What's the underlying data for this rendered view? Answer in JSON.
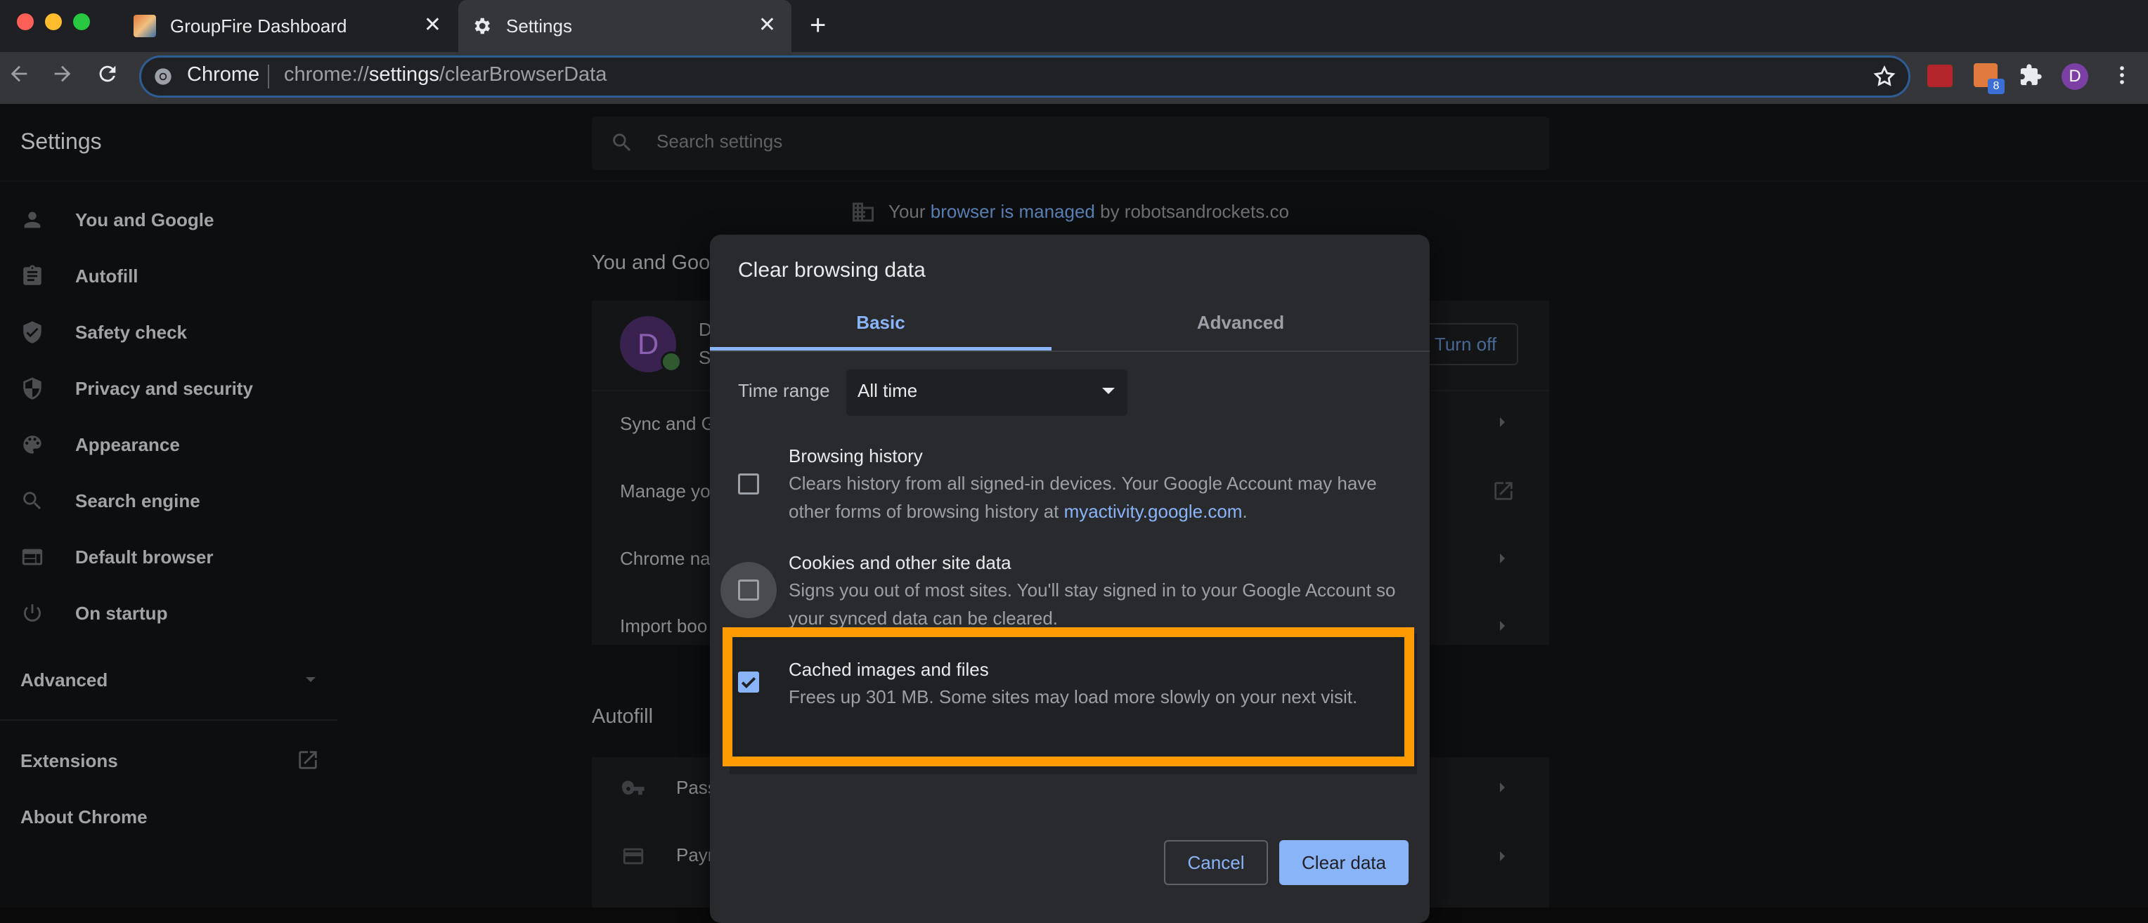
{
  "browser": {
    "tabs": [
      {
        "title": "GroupFire Dashboard",
        "active": false
      },
      {
        "title": "Settings",
        "active": true
      }
    ],
    "new_tab_symbol": "+",
    "close_symbol": "✕",
    "omnibox": {
      "label": "Chrome",
      "url_prefix": "chrome://",
      "url_host": "settings",
      "url_path": "/clearBrowserData"
    },
    "profile_initial": "D",
    "extension_badge": "8"
  },
  "settings": {
    "title": "Settings",
    "search_placeholder": "Search settings",
    "sidebar": [
      {
        "label": "You and Google",
        "icon": "person-icon"
      },
      {
        "label": "Autofill",
        "icon": "clipboard-icon"
      },
      {
        "label": "Safety check",
        "icon": "shield-check-icon"
      },
      {
        "label": "Privacy and security",
        "icon": "shield-icon"
      },
      {
        "label": "Appearance",
        "icon": "palette-icon"
      },
      {
        "label": "Search engine",
        "icon": "search-icon"
      },
      {
        "label": "Default browser",
        "icon": "browser-window-icon"
      },
      {
        "label": "On startup",
        "icon": "power-icon"
      }
    ],
    "advanced_label": "Advanced",
    "extensions_label": "Extensions",
    "about_label": "About Chrome",
    "managed": {
      "prefix": "Your ",
      "link": "browser is managed",
      "suffix": " by robotsandrockets.co"
    },
    "you_and_google_title": "You and Goo",
    "profile_initial": "D",
    "profile_name_partial": "D",
    "profile_sub_partial": "S",
    "turn_off_label": "Turn off",
    "rows": [
      "Sync and G",
      "Manage yo",
      "Chrome na",
      "Import boo"
    ],
    "autofill_title": "Autofill",
    "autofill_rows": [
      "Pass",
      "Paym"
    ]
  },
  "dialog": {
    "title": "Clear browsing data",
    "tabs": {
      "basic": "Basic",
      "advanced": "Advanced"
    },
    "time_range_label": "Time range",
    "time_range_value": "All time",
    "options": [
      {
        "title": "Browsing history",
        "desc_line1": "Clears history from all signed-in devices. Your Google Account may have",
        "desc_line2_prefix": "other forms of browsing history at ",
        "desc_link": "myactivity.google.com",
        "desc_line2_suffix": ".",
        "checked": false
      },
      {
        "title": "Cookies and other site data",
        "desc_line1": "Signs you out of most sites. You'll stay signed in to your Google Account so",
        "desc_line2": "your synced data can be cleared.",
        "checked": false
      },
      {
        "title": "Cached images and files",
        "desc_line1": "Frees up 301 MB. Some sites may load more slowly on your next visit.",
        "checked": true
      }
    ],
    "cancel_label": "Cancel",
    "clear_label": "Clear data"
  },
  "colors": {
    "highlight": "#ff9a00",
    "accent": "#8ab4f8",
    "link": "#8ab4f8"
  }
}
